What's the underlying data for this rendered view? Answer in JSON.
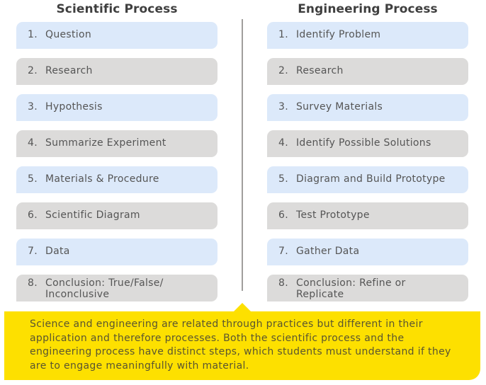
{
  "scientific": {
    "title": "Scientific Process",
    "steps": [
      {
        "num": "1.",
        "label": "Question",
        "color": "blue"
      },
      {
        "num": "2.",
        "label": "Research",
        "color": "gray"
      },
      {
        "num": "3.",
        "label": "Hypothesis",
        "color": "blue"
      },
      {
        "num": "4.",
        "label": "Summarize Experiment",
        "color": "gray"
      },
      {
        "num": "5.",
        "label": "Materials & Procedure",
        "color": "blue"
      },
      {
        "num": "6.",
        "label": "Scientific Diagram",
        "color": "gray"
      },
      {
        "num": "7.",
        "label": "Data",
        "color": "blue"
      },
      {
        "num": "8.",
        "label": "Conclusion: True/False/\nInconclusive",
        "color": "gray"
      }
    ]
  },
  "engineering": {
    "title": "Engineering Process",
    "steps": [
      {
        "num": "1.",
        "label": "Identify Problem",
        "color": "blue"
      },
      {
        "num": "2.",
        "label": "Research",
        "color": "gray"
      },
      {
        "num": "3.",
        "label": "Survey Materials",
        "color": "blue"
      },
      {
        "num": "4.",
        "label": "Identify Possible Solutions",
        "color": "gray"
      },
      {
        "num": "5.",
        "label": "Diagram and Build Prototype",
        "color": "blue"
      },
      {
        "num": "6.",
        "label": "Test Prototype",
        "color": "gray"
      },
      {
        "num": "7.",
        "label": "Gather Data",
        "color": "blue"
      },
      {
        "num": "8.",
        "label": "Conclusion: Refine or\nReplicate",
        "color": "gray"
      }
    ]
  },
  "callout": {
    "text": "Science and engineering are related through practices but different in their application and therefore processes. Both the scientific process and the engineering process have distinct steps, which students must understand if they are to engage meaningfully with material."
  },
  "colors": {
    "blue": "#dce9fa",
    "gray": "#dcdbda",
    "callout": "#fde000"
  }
}
